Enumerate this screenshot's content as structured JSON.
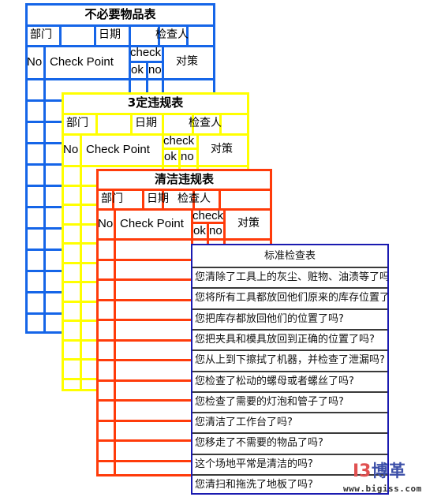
{
  "sheets": [
    {
      "id": "unnecessary-items",
      "title": "不必要物品表",
      "color": "#1565e8",
      "info": {
        "dept": "部门",
        "date": "日期",
        "inspector": "检查人"
      },
      "headers": {
        "no": "No",
        "check_point": "Check Point",
        "check": "check",
        "ok": "ok",
        "ng": "no",
        "countermeasure": "对策"
      }
    },
    {
      "id": "3-fixed-violations",
      "title": "3定违规表",
      "color": "#ffff00",
      "info": {
        "dept": "部门",
        "date": "日期",
        "inspector": "检查人"
      },
      "headers": {
        "no": "No",
        "check_point": "Check Point",
        "check": "check",
        "ok": "ok",
        "ng": "no",
        "countermeasure": "对策"
      }
    },
    {
      "id": "cleaning-violations",
      "title": "清洁违规表",
      "color": "#ff3b0a",
      "info": {
        "dept": "部门",
        "date": "日期",
        "inspector": "检查人"
      },
      "headers": {
        "no": "No",
        "check_point": "Check Point",
        "check": "check",
        "ok": "ok",
        "ng": "no",
        "countermeasure": "对策"
      }
    }
  ],
  "standard": {
    "title": "标准检查表",
    "border_color": "#1a1ab0",
    "items": [
      "您清除了工具上的灰尘、赃物、油渍等了吗?",
      "您将所有工具都放回他们原来的库存位置了吗?",
      "您把库存都放回他们的位置了吗?",
      "您把夹具和模具放回到正确的位置了吗?",
      "您从上到下擦拭了机器，并检查了泄漏吗?",
      "您检查了松动的螺母或者螺丝了吗?",
      "您检查了需要的灯泡和管子了吗?",
      "您清洁了工作台了吗?",
      "您移走了不需要的物品了吗?",
      "这个场地平常是清洁的吗?",
      "您清扫和拖洗了地板了吗?"
    ]
  },
  "logo": {
    "mark": "I3",
    "name": "博革",
    "url": "www.bigiss.com"
  }
}
